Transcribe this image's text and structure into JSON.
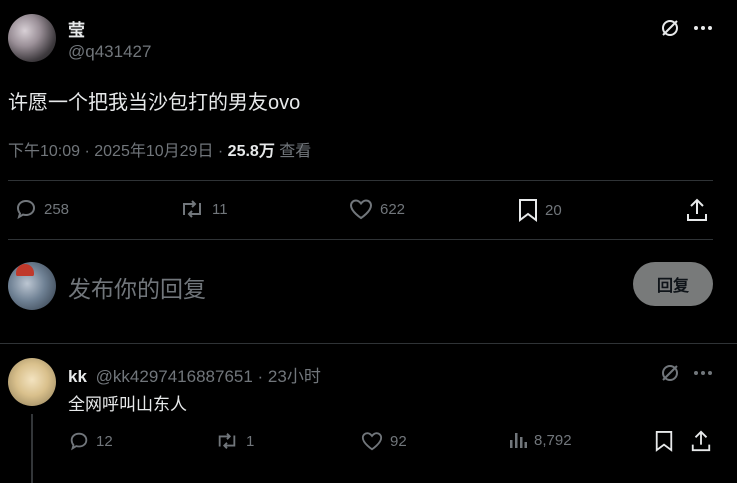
{
  "post": {
    "author_name": "莹",
    "author_handle": "@q431427",
    "text": "许愿一个把我当沙包打的男友ovo",
    "time_date": "下午10:09 · 2025年10月29日 · ",
    "views_count": "25.8万",
    "views_label": " 查看",
    "stats": {
      "replies": "258",
      "reposts": "11",
      "likes": "622",
      "bookmarks": "20"
    }
  },
  "composer": {
    "placeholder": "发布你的回复",
    "button_label": "回复"
  },
  "reply": {
    "author_name": "kk",
    "author_handle": "@kk4297416887651",
    "time": " · 23小时",
    "text": "全网呼叫山东人",
    "stats": {
      "replies": "12",
      "reposts": "1",
      "likes": "92",
      "views": "8,792"
    }
  },
  "icons": [
    "grok-icon",
    "more-icon",
    "reply-icon",
    "repost-icon",
    "like-icon",
    "bookmark-icon",
    "share-icon",
    "views-icon"
  ]
}
